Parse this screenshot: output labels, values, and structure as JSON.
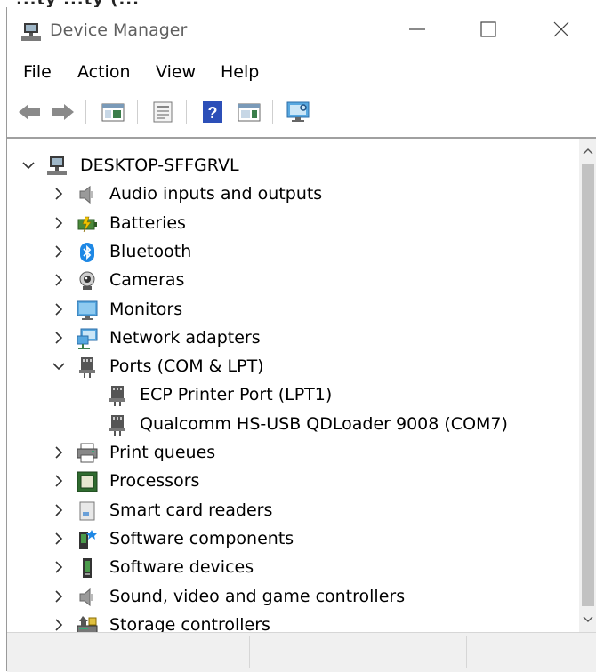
{
  "window": {
    "title": "Device Manager",
    "top_fragment_text": "...ty ...ty (..."
  },
  "menu": [
    "File",
    "Action",
    "View",
    "Help"
  ],
  "toolbar": [
    "back-icon",
    "forward-icon",
    "show-hide-console-tree-icon",
    "properties-icon",
    "help-icon",
    "action-pane-icon",
    "monitor-scan-icon"
  ],
  "tree": {
    "root": "DESKTOP-SFFGRVL",
    "items": [
      {
        "label": "Audio inputs and outputs",
        "icon": "speaker-icon",
        "expanded": false
      },
      {
        "label": "Batteries",
        "icon": "battery-icon",
        "expanded": false
      },
      {
        "label": "Bluetooth",
        "icon": "bluetooth-icon",
        "expanded": false
      },
      {
        "label": "Cameras",
        "icon": "camera-icon",
        "expanded": false
      },
      {
        "label": "Monitors",
        "icon": "monitor-icon",
        "expanded": false
      },
      {
        "label": "Network adapters",
        "icon": "network-icon",
        "expanded": false
      },
      {
        "label": "Ports (COM & LPT)",
        "icon": "port-icon",
        "expanded": true,
        "children": [
          {
            "label": "ECP Printer Port (LPT1)",
            "icon": "port-icon"
          },
          {
            "label": "Qualcomm HS-USB QDLoader 9008 (COM7)",
            "icon": "port-icon"
          }
        ]
      },
      {
        "label": "Print queues",
        "icon": "printer-icon",
        "expanded": false
      },
      {
        "label": "Processors",
        "icon": "processor-icon",
        "expanded": false
      },
      {
        "label": "Smart card readers",
        "icon": "smart-card-icon",
        "expanded": false
      },
      {
        "label": "Software components",
        "icon": "software-component-icon",
        "expanded": false
      },
      {
        "label": "Software devices",
        "icon": "software-device-icon",
        "expanded": false
      },
      {
        "label": "Sound, video and game controllers",
        "icon": "speaker-icon",
        "expanded": false
      },
      {
        "label": "Storage controllers",
        "icon": "storage-icon",
        "expanded": false
      }
    ]
  },
  "colors": {
    "accent": "#1e88e5",
    "title_text": "#5f5f5f",
    "statusbar": "#f0f0f0"
  }
}
